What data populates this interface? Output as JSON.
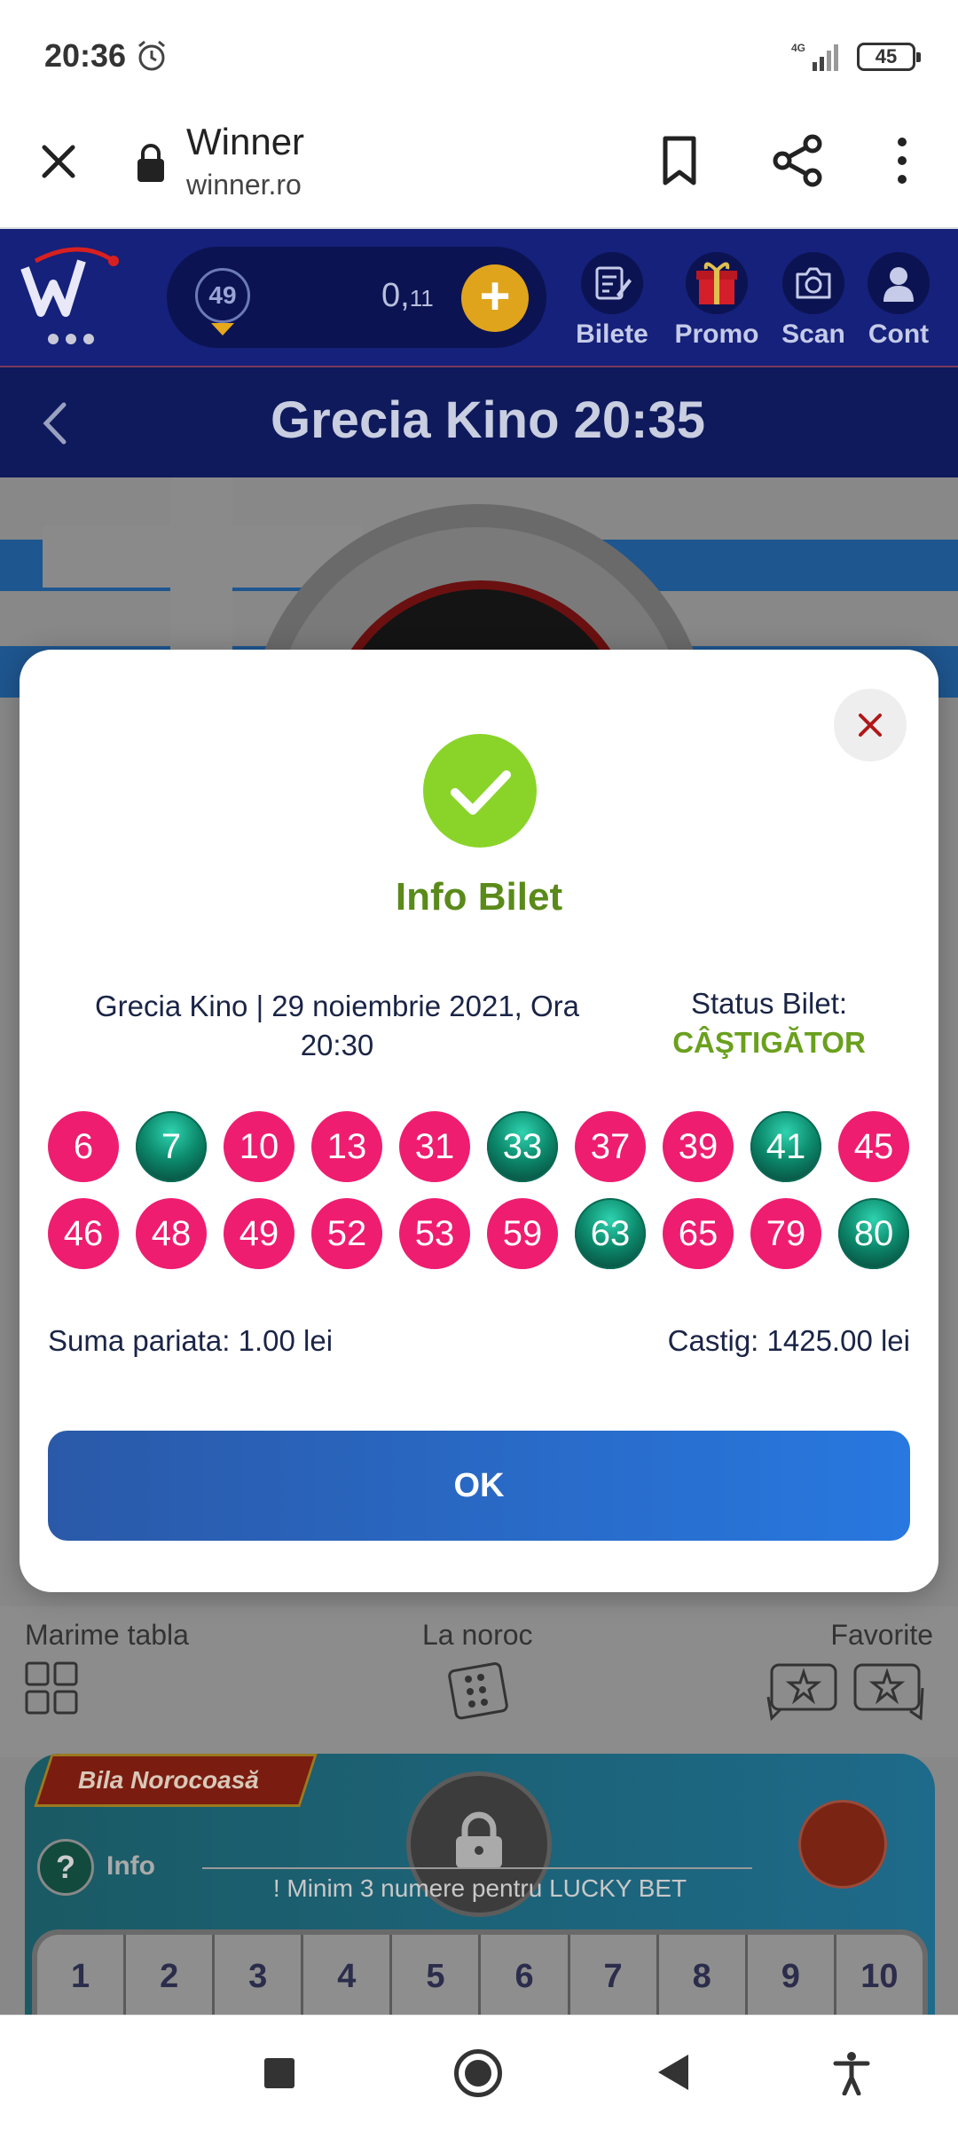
{
  "status_bar": {
    "time": "20:36",
    "network": "4G",
    "battery": "45"
  },
  "browser": {
    "title": "Winner",
    "url": "winner.ro"
  },
  "header": {
    "level_badge": "49",
    "balance_main": "0,",
    "balance_cents": "11",
    "nav": [
      {
        "label": "Bilete"
      },
      {
        "label": "Promo"
      },
      {
        "label": "Scan"
      },
      {
        "label": "Cont"
      }
    ]
  },
  "game": {
    "title": "Grecia Kino 20:35"
  },
  "controls": {
    "board_size": "Marime tabla",
    "random": "La noroc",
    "favorites": "Favorite"
  },
  "bila": {
    "tag": "Bila Norocoasă",
    "info": "Info",
    "info_mark": "?",
    "lucky_hint": "! Minim 3 numere pentru LUCKY BET",
    "numbers": [
      "1",
      "2",
      "3",
      "4",
      "5",
      "6",
      "7",
      "8",
      "9",
      "10"
    ]
  },
  "modal": {
    "title": "Info Bilet",
    "draw_line1": "Grecia Kino | 29 noiembrie 2021, Ora",
    "draw_line2": "20:30",
    "status_label": "Status Bilet:",
    "status_value": "CÂŞTIGĂTOR",
    "balls": [
      {
        "n": "6",
        "hit": false
      },
      {
        "n": "7",
        "hit": true
      },
      {
        "n": "10",
        "hit": false
      },
      {
        "n": "13",
        "hit": false
      },
      {
        "n": "31",
        "hit": false
      },
      {
        "n": "33",
        "hit": true
      },
      {
        "n": "37",
        "hit": false
      },
      {
        "n": "39",
        "hit": false
      },
      {
        "n": "41",
        "hit": true
      },
      {
        "n": "45",
        "hit": false
      },
      {
        "n": "46",
        "hit": false
      },
      {
        "n": "48",
        "hit": false
      },
      {
        "n": "49",
        "hit": false
      },
      {
        "n": "52",
        "hit": false
      },
      {
        "n": "53",
        "hit": false
      },
      {
        "n": "59",
        "hit": false
      },
      {
        "n": "63",
        "hit": true
      },
      {
        "n": "65",
        "hit": false
      },
      {
        "n": "79",
        "hit": false
      },
      {
        "n": "80",
        "hit": true
      }
    ],
    "stake": "Suma pariata: 1.00 lei",
    "win": "Castig: 1425.00 lei",
    "ok_label": "OK"
  },
  "colors": {
    "header_bg": "#15217a",
    "success_green": "#8ad42a",
    "status_green": "#6aa01e",
    "ball_pink": "#ee1d70",
    "ball_green": "#0c8a6c",
    "ok_blue": "#2878e0"
  },
  "icons": {
    "alarm": "alarm-clock-icon",
    "close": "close-icon",
    "lock": "lock-icon",
    "bookmark": "bookmark-icon",
    "share": "share-icon",
    "more": "more-vertical-icon",
    "success": "checkmark-icon"
  }
}
